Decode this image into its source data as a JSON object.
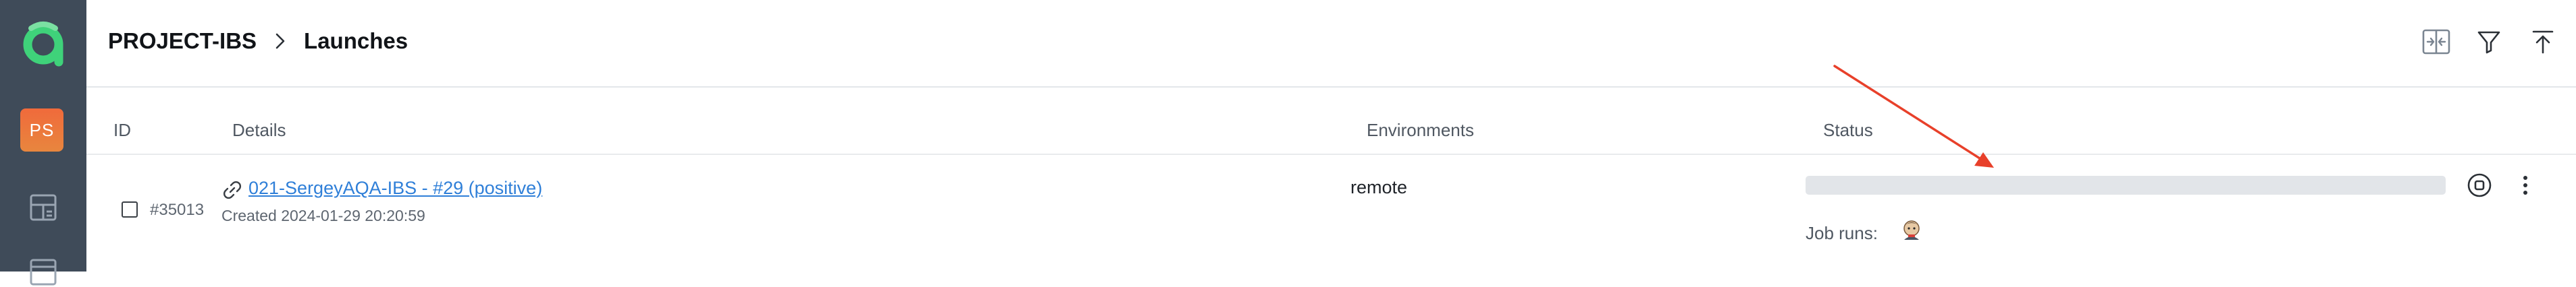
{
  "sidebar": {
    "logo_icon": "allure-logo-icon",
    "project_avatar": "PS",
    "project_avatar_colors": [
      "#f06a3b",
      "#e8863e"
    ],
    "items": [
      {
        "icon": "dashboard-icon"
      },
      {
        "icon": "table-icon"
      }
    ]
  },
  "header": {
    "breadcrumb": {
      "project": "PROJECT-IBS",
      "separator_icon": "chevron-right-icon",
      "page": "Launches"
    },
    "toolbar": [
      {
        "icon": "compare-icon"
      },
      {
        "icon": "filter-icon"
      },
      {
        "icon": "upload-icon"
      }
    ]
  },
  "table": {
    "columns": {
      "id": "ID",
      "details": "Details",
      "environments": "Environments",
      "status": "Status"
    },
    "rows": [
      {
        "id": "#35013",
        "link_icon": "link-icon",
        "name": "021-SergeyAQA-IBS - #29 (positive)",
        "created": "Created 2024-01-29 20:20:59",
        "environment": "remote",
        "status_progress": 0,
        "job_runs_label": "Job runs:",
        "job_avatar_icon": "jenkins-avatar-icon",
        "actions": [
          {
            "icon": "stop-icon"
          },
          {
            "icon": "more-vertical-icon"
          }
        ]
      }
    ]
  },
  "colors": {
    "sidebar": "#3f4b59",
    "link": "#2f7fd8",
    "annotation_arrow": "#e8402a",
    "progress_track": "#e2e5e9"
  }
}
